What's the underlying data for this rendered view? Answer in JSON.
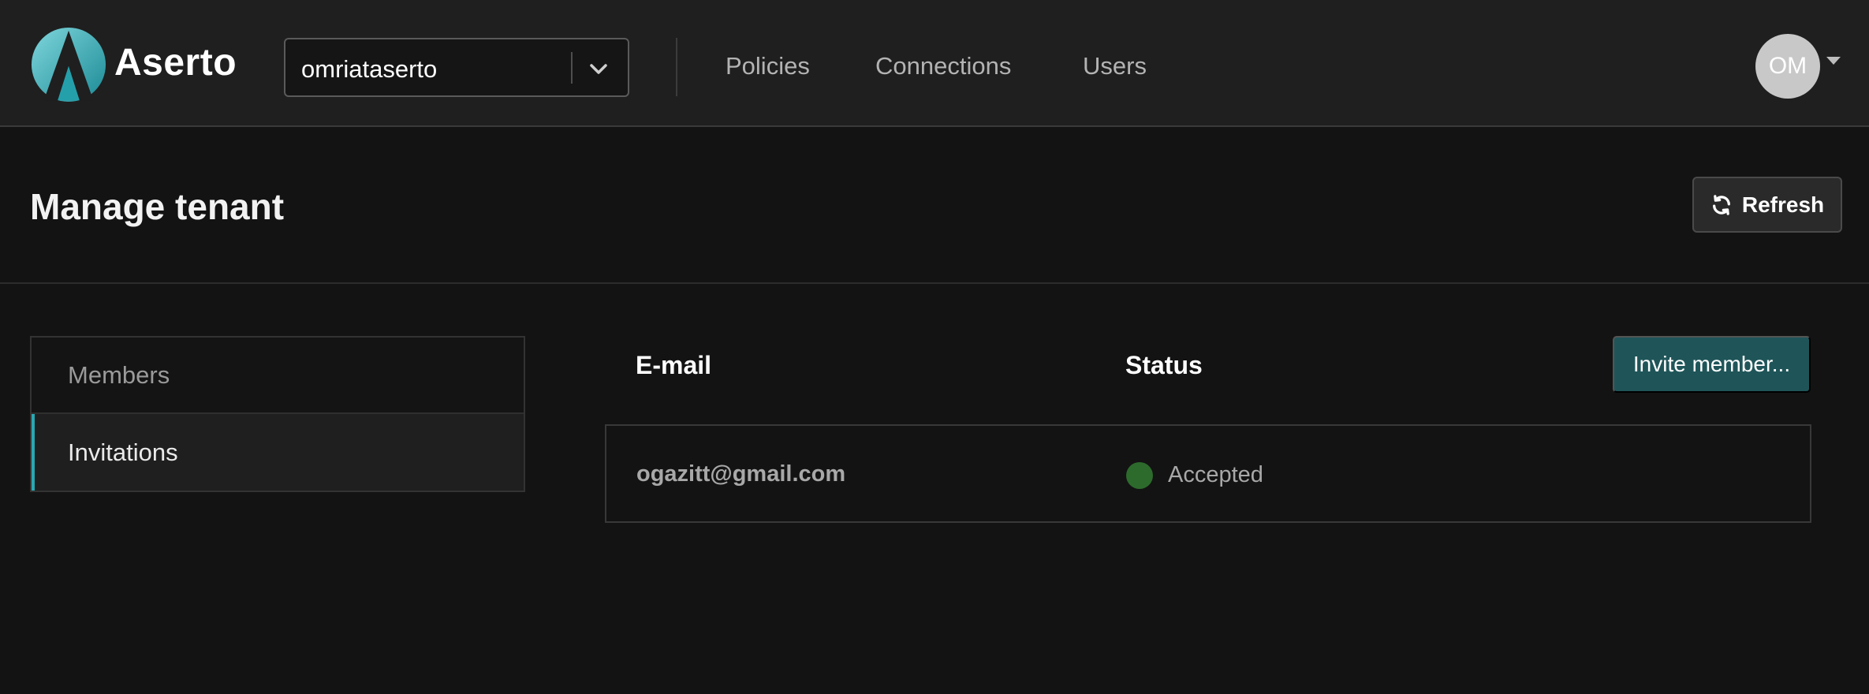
{
  "header": {
    "brand": "Aserto",
    "tenant": {
      "selected": "omriataserto"
    },
    "nav": [
      {
        "label": "Policies"
      },
      {
        "label": "Connections"
      },
      {
        "label": "Users"
      }
    ],
    "avatar_initials": "OM"
  },
  "page": {
    "title": "Manage tenant",
    "refresh_label": "Refresh"
  },
  "sidebar": {
    "items": [
      {
        "label": "Members",
        "active": false
      },
      {
        "label": "Invitations",
        "active": true
      }
    ]
  },
  "table": {
    "columns": [
      "E-mail",
      "Status"
    ],
    "invite_label": "Invite member...",
    "rows": [
      {
        "email": "ogazitt@gmail.com",
        "status": "Accepted",
        "status_color": "#2d6b2c"
      }
    ]
  },
  "colors": {
    "accent": "#2aa8b3",
    "invite_button": "#1f5559",
    "background": "#131313",
    "navbar": "#1f1f1f"
  },
  "icons": [
    "aserto-logo",
    "chevron-down-icon",
    "refresh-icon",
    "caret-down-icon",
    "status-dot-icon"
  ]
}
